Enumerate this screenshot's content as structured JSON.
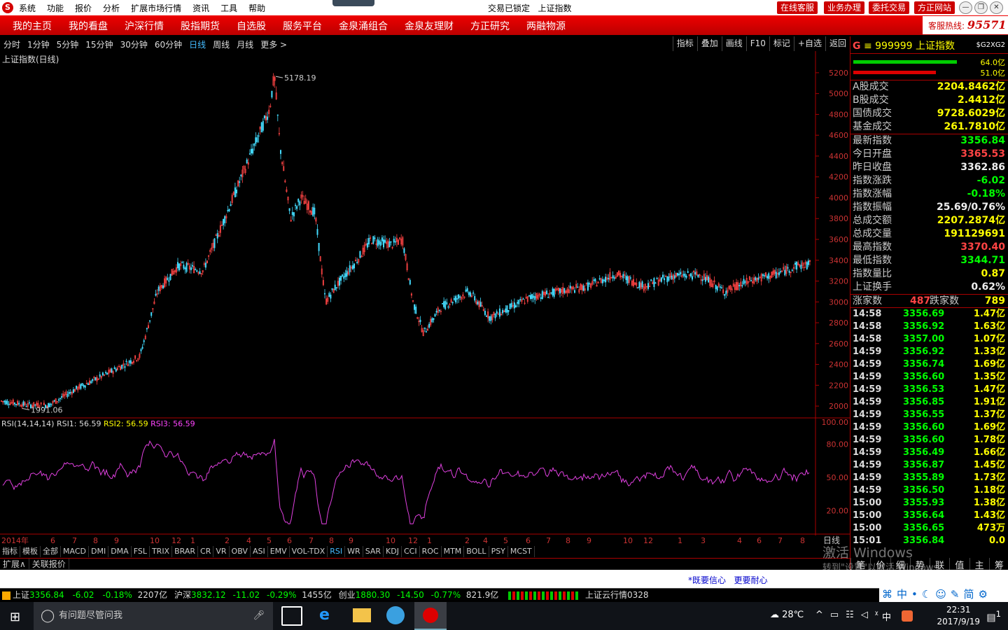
{
  "titlebar": {
    "menu": [
      "系统",
      "功能",
      "报价",
      "分析",
      "扩展市场行情",
      "资讯",
      "工具",
      "帮助"
    ],
    "center_status": "交易已锁定",
    "center_title": "上证指数",
    "right_buttons": [
      "在线客服",
      "业务办理",
      "委托交易",
      "方正网站"
    ]
  },
  "navbar": {
    "items": [
      "我的主页",
      "我的看盘",
      "沪深行情",
      "股指期货",
      "自选股",
      "服务平台",
      "金泉涌组合",
      "金泉友理财",
      "方正研究",
      "两融物源"
    ],
    "hotline_label": "客服热线:",
    "hotline_number": "95571"
  },
  "timeframes": {
    "items": [
      "分时",
      "1分钟",
      "5分钟",
      "15分钟",
      "30分钟",
      "60分钟",
      "日线",
      "周线",
      "月线",
      "更多 >"
    ],
    "active": "日线"
  },
  "chart_tools": [
    "指标",
    "叠加",
    "画线",
    "F10",
    "标记",
    "+自选",
    "返回"
  ],
  "chart": {
    "title": "上证指数(日线)",
    "max_label": "5178.19",
    "min_label": "1991.06",
    "y_ticks": [
      "5200",
      "5000",
      "4800",
      "4600",
      "4400",
      "4200",
      "4000",
      "3800",
      "3600",
      "3400",
      "3200",
      "3000",
      "2800",
      "2600",
      "2400",
      "2200",
      "2000"
    ],
    "rsi_title": "RSI(14,14,14)",
    "rsi1_label": "RSI1: 56.59",
    "rsi2_label": "RSI2: 56.59",
    "rsi3_label": "RSI3: 56.59",
    "rsi_ticks": [
      "100.00",
      "80.00",
      "50.00",
      "20.00"
    ],
    "x_labels": [
      "2014年",
      "6",
      "7",
      "8",
      "9",
      "10",
      "12",
      "1",
      "2",
      "4",
      "5",
      "6",
      "7",
      "8",
      "9",
      "10",
      "12",
      "1",
      "2",
      "4",
      "5",
      "6",
      "7",
      "8",
      "9",
      "10",
      "12",
      "1",
      "3",
      "4",
      "6",
      "7",
      "8",
      "9"
    ],
    "period_label": "日线"
  },
  "chart_data": {
    "type": "candlestick",
    "title": "上证指数(日线)",
    "ylim": [
      1900,
      5300
    ],
    "max": 5178.19,
    "min": 1991.06,
    "rsi": {
      "name": "RSI(14,14,14)",
      "values": {
        "RSI1": 56.59,
        "RSI2": 56.59,
        "RSI3": 56.59
      },
      "ticks": [
        100,
        80,
        50,
        20
      ]
    },
    "trend_points": [
      [
        0,
        2050
      ],
      [
        40,
        2010
      ],
      [
        70,
        2010
      ],
      [
        110,
        2170
      ],
      [
        150,
        2300
      ],
      [
        200,
        2480
      ],
      [
        225,
        3100
      ],
      [
        255,
        3350
      ],
      [
        290,
        3300
      ],
      [
        310,
        3620
      ],
      [
        345,
        4200
      ],
      [
        385,
        4850
      ],
      [
        392,
        5178
      ],
      [
        400,
        4500
      ],
      [
        415,
        3800
      ],
      [
        430,
        4000
      ],
      [
        450,
        3850
      ],
      [
        465,
        3000
      ],
      [
        480,
        3150
      ],
      [
        510,
        3400
      ],
      [
        530,
        3600
      ],
      [
        560,
        3550
      ],
      [
        575,
        3600
      ],
      [
        590,
        3000
      ],
      [
        605,
        2700
      ],
      [
        630,
        2950
      ],
      [
        670,
        3100
      ],
      [
        700,
        2850
      ],
      [
        730,
        2950
      ],
      [
        760,
        3050
      ],
      [
        800,
        3100
      ],
      [
        840,
        3150
      ],
      [
        880,
        3270
      ],
      [
        920,
        3150
      ],
      [
        960,
        3250
      ],
      [
        1000,
        3260
      ],
      [
        1035,
        3100
      ],
      [
        1070,
        3200
      ],
      [
        1110,
        3270
      ],
      [
        1140,
        3350
      ],
      [
        1158,
        3357
      ]
    ]
  },
  "indicator_tabs": [
    "指标",
    "模板",
    "全部",
    "MACD",
    "DMI",
    "DMA",
    "FSL",
    "TRIX",
    "BRAR",
    "CR",
    "VR",
    "OBV",
    "ASI",
    "EMV",
    "VOL-TDX",
    "RSI",
    "WR",
    "SAR",
    "KDJ",
    "CCI",
    "ROC",
    "MTM",
    "BOLL",
    "PSY",
    "MCST"
  ],
  "indicator_active": "RSI",
  "bottom_tabs": [
    "扩展∧",
    "关联报价"
  ],
  "right_panel": {
    "code": "999999",
    "name": "上证指数",
    "tag": "$G2XG2",
    "bar1_value": "64.0亿",
    "bar2_value": "51.0亿",
    "turnover": [
      {
        "label": "A股成交",
        "value": "2204.8462亿"
      },
      {
        "label": "B股成交",
        "value": "2.4412亿"
      },
      {
        "label": "国债成交",
        "value": "9728.6029亿"
      },
      {
        "label": "基金成交",
        "value": "261.7810亿"
      }
    ],
    "quotes": [
      {
        "label": "最新指数",
        "value": "3356.84",
        "color": "green"
      },
      {
        "label": "今日开盘",
        "value": "3365.53",
        "color": "red"
      },
      {
        "label": "昨日收盘",
        "value": "3362.86",
        "color": "white"
      },
      {
        "label": "指数涨跌",
        "value": "-6.02",
        "color": "green"
      },
      {
        "label": "指数涨幅",
        "value": "-0.18%",
        "color": "green"
      },
      {
        "label": "指数振幅",
        "value": "25.69/0.76%",
        "color": "white"
      },
      {
        "label": "总成交额",
        "value": "2207.2874亿",
        "color": "yellow"
      },
      {
        "label": "总成交量",
        "value": "191129691",
        "color": "yellow"
      },
      {
        "label": "最高指数",
        "value": "3370.40",
        "color": "red"
      },
      {
        "label": "最低指数",
        "value": "3344.71",
        "color": "green"
      },
      {
        "label": "指数量比",
        "value": "0.87",
        "color": "yellow"
      },
      {
        "label": "上证换手",
        "value": "0.62%",
        "color": "white"
      }
    ],
    "up_label": "涨家数",
    "up_count": "487",
    "down_label": "跌家数",
    "down_count": "789",
    "ticks": [
      {
        "t": "14:58",
        "p": "3356.69",
        "a": "1.47亿"
      },
      {
        "t": "14:58",
        "p": "3356.92",
        "a": "1.63亿"
      },
      {
        "t": "14:58",
        "p": "3357.00",
        "a": "1.07亿"
      },
      {
        "t": "14:59",
        "p": "3356.92",
        "a": "1.33亿"
      },
      {
        "t": "14:59",
        "p": "3356.74",
        "a": "1.69亿"
      },
      {
        "t": "14:59",
        "p": "3356.60",
        "a": "1.35亿"
      },
      {
        "t": "14:59",
        "p": "3356.53",
        "a": "1.47亿"
      },
      {
        "t": "14:59",
        "p": "3356.85",
        "a": "1.91亿"
      },
      {
        "t": "14:59",
        "p": "3356.55",
        "a": "1.37亿"
      },
      {
        "t": "14:59",
        "p": "3356.60",
        "a": "1.69亿"
      },
      {
        "t": "14:59",
        "p": "3356.60",
        "a": "1.78亿"
      },
      {
        "t": "14:59",
        "p": "3356.49",
        "a": "1.66亿"
      },
      {
        "t": "14:59",
        "p": "3356.87",
        "a": "1.45亿"
      },
      {
        "t": "14:59",
        "p": "3355.89",
        "a": "1.73亿"
      },
      {
        "t": "14:59",
        "p": "3356.50",
        "a": "1.18亿"
      },
      {
        "t": "15:00",
        "p": "3355.93",
        "a": "1.38亿"
      },
      {
        "t": "15:00",
        "p": "3356.64",
        "a": "1.43亿"
      },
      {
        "t": "15:00",
        "p": "3356.65",
        "a": "473万"
      },
      {
        "t": "15:01",
        "p": "3356.84",
        "a": "0.0"
      }
    ],
    "bottom_tabs": [
      "笔",
      "价",
      "细",
      "势",
      "联",
      "值",
      "主",
      "筹"
    ]
  },
  "links": {
    "a": "*既要信心",
    "b": "更要耐心"
  },
  "status": {
    "sh_label": "上证",
    "sh_value": "3356.84",
    "sh_change": "-6.02",
    "sh_pct": "-0.18%",
    "sh_amount": "2207亿",
    "hs_label": "沪深",
    "hs_value": "3832.12",
    "hs_change": "-11.02",
    "hs_pct": "-0.29%",
    "hs_amount": "1455亿",
    "cy_label": "创业",
    "cy_value": "1880.30",
    "cy_change": "-14.50",
    "cy_pct": "-0.77%",
    "cy_amount": "821.9亿",
    "cloud": "上证云行情0328"
  },
  "watermark": {
    "line1": "激活 Windows",
    "line2": "转到\"设置\"以激活 Windows。"
  },
  "taskbar": {
    "search_placeholder": "有问题尽管问我",
    "weather": "28℃",
    "ime": "中",
    "time": "22:31",
    "date": "2017/9/19",
    "notif": "1"
  }
}
